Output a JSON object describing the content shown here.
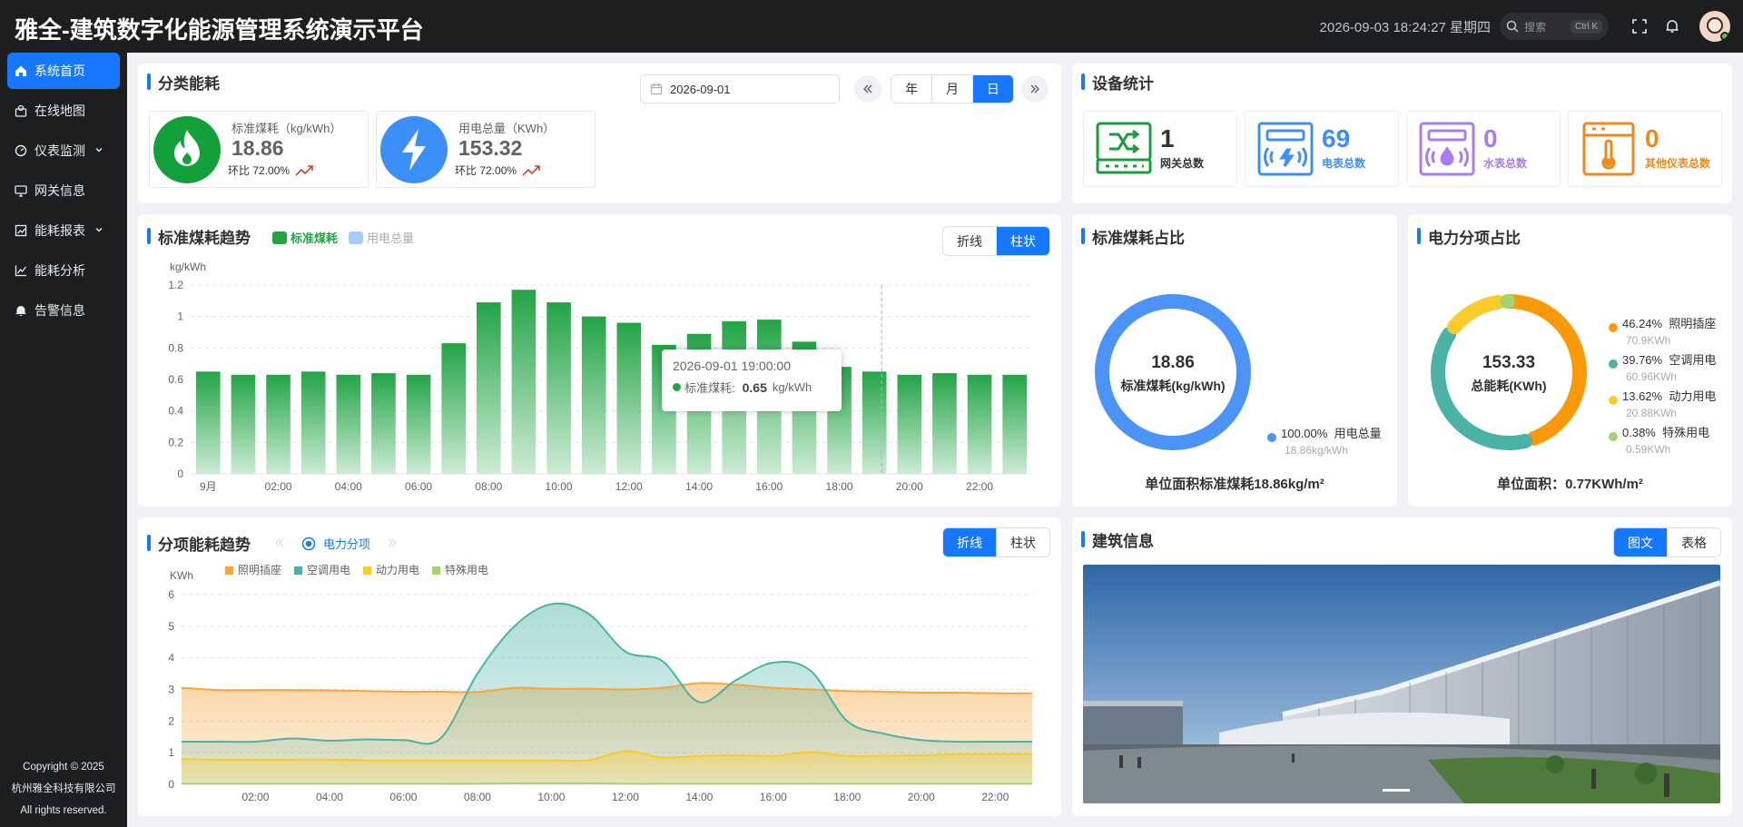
{
  "app": {
    "title": "雅全-建筑数字化能源管理系统演示平台"
  },
  "topbar": {
    "datetime": "2026-09-03 18:24:27 星期四",
    "search_placeholder": "搜索",
    "search_shortcut": "Ctrl K"
  },
  "sidebar": {
    "items": [
      {
        "label": "系统首页",
        "icon": "home-icon",
        "active": true
      },
      {
        "label": "在线地图",
        "icon": "map-icon"
      },
      {
        "label": "仪表监测",
        "icon": "meter-icon",
        "expandable": true
      },
      {
        "label": "网关信息",
        "icon": "monitor-icon"
      },
      {
        "label": "能耗报表",
        "icon": "report-icon",
        "expandable": true
      },
      {
        "label": "能耗分析",
        "icon": "analysis-icon"
      },
      {
        "label": "告警信息",
        "icon": "bell-icon"
      }
    ],
    "copyright": [
      "Copyright © 2025",
      "杭州雅全科技有限公司",
      "All rights reserved."
    ]
  },
  "category": {
    "title": "分类能耗",
    "date": "2026-09-01",
    "periods": [
      "年",
      "月",
      "日"
    ],
    "active_period": "日",
    "kpis": [
      {
        "label": "标准煤耗（kg/kWh）",
        "value": "18.86",
        "ratio": "环比 72.00%",
        "color": "#13a03a"
      },
      {
        "label": "用电总量（KWh）",
        "value": "153.32",
        "ratio": "环比 72.00%",
        "color": "#3d8ff8"
      }
    ]
  },
  "devices": {
    "title": "设备统计",
    "items": [
      {
        "count": "1",
        "label": "网关总数",
        "color": "#1a9c3e",
        "count_color": "#303133",
        "label_color": "#303133"
      },
      {
        "count": "69",
        "label": "电表总数",
        "color": "#3d8ff8",
        "count_color": "#3d8ff8",
        "label_color": "#3d8ff8"
      },
      {
        "count": "0",
        "label": "水表总数",
        "color": "#a77cf5",
        "count_color": "#a77cf5",
        "label_color": "#a77cf5"
      },
      {
        "count": "0",
        "label": "其他仪表总数",
        "color": "#f0891c",
        "count_color": "#f0891c",
        "label_color": "#f0891c"
      }
    ]
  },
  "coal_trend": {
    "title": "标准煤耗趋势",
    "legend": [
      "标准煤耗",
      "用电总量"
    ],
    "modes": [
      "折线",
      "柱状"
    ],
    "active_mode": "柱状",
    "tooltip": {
      "time": "2026-09-01 19:00:00",
      "label": "标准煤耗:",
      "value": "0.65",
      "unit": "kg/kWh"
    }
  },
  "coal_ratio": {
    "title": "标准煤耗占比",
    "center_value": "18.86",
    "center_label": "标准煤耗(kg/kWh)",
    "legend": [
      {
        "pct": "100.00%",
        "name": "用电总量",
        "sub": "18.86kg/kWh",
        "color": "#4b93f7"
      }
    ],
    "footer": "单位面积标准煤耗18.86kg/m²"
  },
  "power_ratio": {
    "title": "电力分项占比",
    "center_value": "153.33",
    "center_label": "总能耗(KWh)",
    "legend": [
      {
        "pct": "46.24%",
        "name": "照明插座",
        "sub": "70.9KWh",
        "color": "#fa9a0a"
      },
      {
        "pct": "39.76%",
        "name": "空调用电",
        "sub": "60.96KWh",
        "color": "#4ab3a5"
      },
      {
        "pct": "13.62%",
        "name": "动力用电",
        "sub": "20.88KWh",
        "color": "#f9cb2c"
      },
      {
        "pct": "0.38%",
        "name": "特殊用电",
        "sub": "0.59KWh",
        "color": "#a4d46c"
      }
    ],
    "footer": "单位面积：0.77KWh/m²"
  },
  "sub_trend": {
    "title": "分项能耗趋势",
    "tab": "电力分项",
    "modes": [
      "折线",
      "柱状"
    ],
    "active_mode": "折线"
  },
  "building": {
    "title": "建筑信息",
    "modes": [
      "图文",
      "表格"
    ],
    "active_mode": "图文"
  },
  "chart_data": [
    {
      "type": "bar",
      "ylabel": "kg/kWh",
      "ylim": [
        0,
        1.2
      ],
      "yticks": [
        "0",
        "0.2",
        "0.4",
        "0.6",
        "0.8",
        "1",
        "1.2"
      ],
      "categories": [
        "9月",
        "01:00",
        "02:00",
        "03:00",
        "04:00",
        "05:00",
        "06:00",
        "07:00",
        "08:00",
        "09:00",
        "10:00",
        "11:00",
        "12:00",
        "13:00",
        "14:00",
        "15:00",
        "16:00",
        "17:00",
        "18:00",
        "19:00",
        "20:00",
        "21:00",
        "22:00",
        "23:00"
      ],
      "xtick_labels": [
        "9月",
        "02:00",
        "04:00",
        "06:00",
        "08:00",
        "10:00",
        "12:00",
        "14:00",
        "16:00",
        "18:00",
        "20:00",
        "22:00"
      ],
      "series": [
        {
          "name": "标准煤耗",
          "color": "#23a446",
          "values": [
            0.65,
            0.63,
            0.63,
            0.65,
            0.63,
            0.64,
            0.63,
            0.83,
            1.09,
            1.17,
            1.09,
            1.0,
            0.96,
            0.82,
            0.89,
            0.97,
            0.98,
            0.84,
            0.68,
            0.65,
            0.63,
            0.64,
            0.63,
            0.63
          ]
        },
        {
          "name": "用电总量",
          "color": "#a8ccfa",
          "values": []
        }
      ],
      "legend": "top-left",
      "grid": true
    },
    {
      "type": "area",
      "ylabel": "KWh",
      "ylim": [
        0,
        6
      ],
      "yticks": [
        "0",
        "1",
        "2",
        "3",
        "4",
        "5",
        "6"
      ],
      "xtick_labels": [
        "02:00",
        "04:00",
        "06:00",
        "08:00",
        "10:00",
        "12:00",
        "14:00",
        "16:00",
        "18:00",
        "20:00",
        "22:00"
      ],
      "x": [
        "00:00",
        "01:00",
        "02:00",
        "03:00",
        "04:00",
        "05:00",
        "06:00",
        "07:00",
        "08:00",
        "09:00",
        "10:00",
        "11:00",
        "12:00",
        "13:00",
        "14:00",
        "15:00",
        "16:00",
        "17:00",
        "18:00",
        "19:00",
        "20:00",
        "21:00",
        "22:00",
        "23:00"
      ],
      "series": [
        {
          "name": "照明插座",
          "color": "#f7a53a",
          "values": [
            3.05,
            2.98,
            2.98,
            2.98,
            2.97,
            2.95,
            2.93,
            2.93,
            2.92,
            3.05,
            3.02,
            3.02,
            3.0,
            3.05,
            3.2,
            3.15,
            3.05,
            3.0,
            2.95,
            2.93,
            2.9,
            2.9,
            2.88,
            2.88
          ]
        },
        {
          "name": "空调用电",
          "color": "#4ab3a5",
          "values": [
            1.35,
            1.35,
            1.35,
            1.45,
            1.38,
            1.42,
            1.4,
            1.45,
            3.5,
            5.0,
            5.7,
            5.4,
            4.2,
            3.9,
            2.6,
            3.3,
            3.85,
            3.6,
            2.0,
            1.6,
            1.4,
            1.35,
            1.35,
            1.35
          ]
        },
        {
          "name": "动力用电",
          "color": "#f9cb2c",
          "values": [
            0.8,
            0.78,
            0.78,
            0.78,
            0.78,
            0.76,
            0.76,
            0.76,
            0.76,
            0.76,
            0.76,
            0.76,
            1.05,
            0.85,
            0.9,
            0.92,
            0.9,
            1.02,
            0.9,
            0.9,
            0.92,
            0.95,
            0.95,
            0.95
          ]
        },
        {
          "name": "特殊用电",
          "color": "#a4d46c",
          "values": [
            0.02,
            0.02,
            0.02,
            0.02,
            0.02,
            0.02,
            0.02,
            0.02,
            0.02,
            0.03,
            0.03,
            0.03,
            0.02,
            0.02,
            0.02,
            0.02,
            0.02,
            0.02,
            0.02,
            0.02,
            0.02,
            0.02,
            0.02,
            0.02
          ]
        }
      ],
      "legend": "top-left",
      "grid": true
    },
    {
      "type": "pie",
      "title": "标准煤耗占比",
      "slices": [
        {
          "name": "用电总量",
          "value": 18.86,
          "pct": 100.0,
          "color": "#4b93f7"
        }
      ]
    },
    {
      "type": "pie",
      "title": "电力分项占比",
      "slices": [
        {
          "name": "照明插座",
          "value": 70.9,
          "pct": 46.24,
          "color": "#fa9a0a"
        },
        {
          "name": "空调用电",
          "value": 60.96,
          "pct": 39.76,
          "color": "#4ab3a5"
        },
        {
          "name": "动力用电",
          "value": 20.88,
          "pct": 13.62,
          "color": "#f9cb2c"
        },
        {
          "name": "特殊用电",
          "value": 0.59,
          "pct": 0.38,
          "color": "#a4d46c"
        }
      ]
    }
  ]
}
